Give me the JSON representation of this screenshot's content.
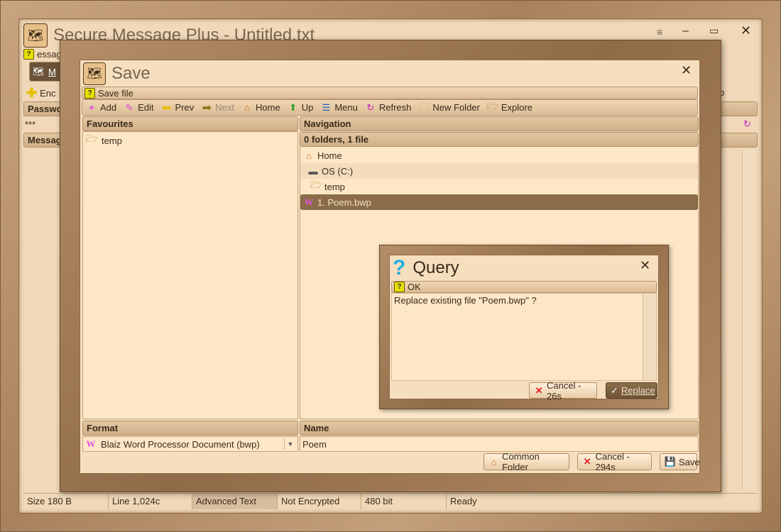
{
  "main_window": {
    "title": "Secure Message Plus - Untitled.txt",
    "hint_text": "essage",
    "tab_label": "M",
    "encrypt_label": "Enc",
    "right_label": "p",
    "password_label": "Passwo",
    "password_value": "***",
    "message_label": "Messag"
  },
  "status_bar": {
    "size": "Size 180 B",
    "line": "Line 1,024c",
    "mode": "Advanced Text",
    "encryption": "Not Encrypted",
    "bits": "480 bit",
    "state": "Ready"
  },
  "save_dialog": {
    "title": "Save",
    "hint": "Save file",
    "toolbar": {
      "add": "Add",
      "edit": "Edit",
      "prev": "Prev",
      "next": "Next",
      "home": "Home",
      "up": "Up",
      "menu": "Menu",
      "refresh": "Refresh",
      "new_folder": "New Folder",
      "explore": "Explore"
    },
    "favourites": {
      "header": "Favourites",
      "items": [
        "temp"
      ]
    },
    "navigation": {
      "header": "Navigation",
      "summary": "0 folders, 1 file",
      "home": "Home",
      "drive": "OS (C:)",
      "folder": "temp",
      "file": "1. Poem.bwp"
    },
    "format": {
      "header": "Format",
      "value": "Blaiz Word Processor Document (bwp)"
    },
    "name": {
      "header": "Name",
      "value": "Poem"
    },
    "buttons": {
      "common_folder": "Common Folder",
      "cancel": "Cancel - 294s",
      "save": "Save"
    }
  },
  "query_dialog": {
    "title": "Query",
    "hint": "OK",
    "message": "Replace existing file \"Poem.bwp\" ?",
    "cancel": "Cancel - 26s",
    "replace": "Replace"
  }
}
